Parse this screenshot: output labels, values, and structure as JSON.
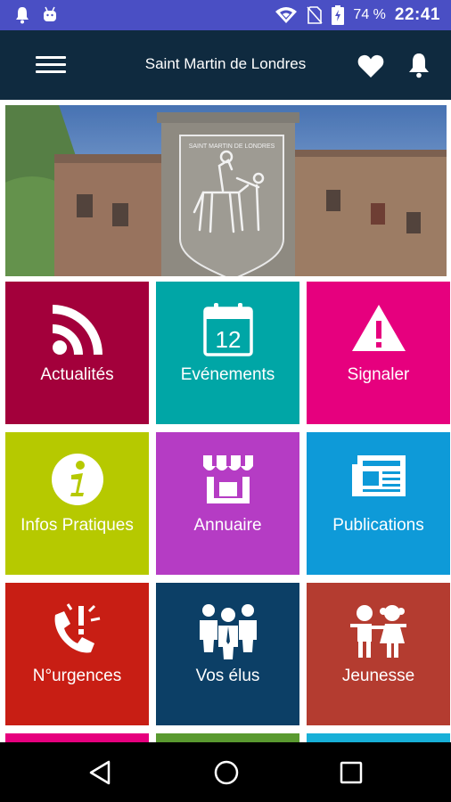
{
  "status_bar": {
    "battery_percent": "74 %",
    "time": "22:41",
    "left_icons": [
      "notification-bell-icon",
      "android-icon"
    ],
    "right_icons": [
      "wifi-icon",
      "no-sim-icon",
      "battery-charging-icon"
    ]
  },
  "app_bar": {
    "title": "Saint Martin de Londres",
    "menu_icon": "menu-icon",
    "favorite_icon": "heart-icon",
    "notifications_icon": "bell-icon"
  },
  "banner": {
    "crest_text": "SAINT MARTIN DE LONDRES"
  },
  "tiles": [
    {
      "label": "Actualités",
      "icon": "rss-icon",
      "color": "#a3003b"
    },
    {
      "label": "Evénements",
      "icon": "calendar-icon",
      "color": "#00a6a6",
      "calendar_day": "12"
    },
    {
      "label": "Signaler",
      "icon": "warning-icon",
      "color": "#e6007e"
    },
    {
      "label": "Infos Pratiques",
      "icon": "info-icon",
      "color": "#b6c900"
    },
    {
      "label": "Annuaire",
      "icon": "shop-icon",
      "color": "#b53cc4"
    },
    {
      "label": "Publications",
      "icon": "newspaper-icon",
      "color": "#0e9ad8"
    },
    {
      "label": "N°urgences",
      "icon": "emergency-phone-icon",
      "color": "#c81e14"
    },
    {
      "label": "Vos élus",
      "icon": "people-icon",
      "color": "#0c3f66"
    },
    {
      "label": "Jeunesse",
      "icon": "children-icon",
      "color": "#b43c30"
    }
  ],
  "partial_tiles_colors": [
    "#e6007e",
    "#5a9a30",
    "#18b0d8"
  ],
  "nav_bar": {
    "back_icon": "back-icon",
    "home_icon": "home-icon",
    "recents_icon": "recents-icon"
  }
}
